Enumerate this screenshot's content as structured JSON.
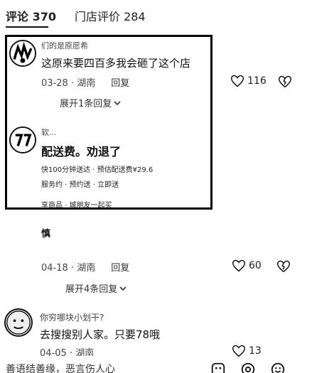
{
  "tabs": [
    {
      "label": "评论 370"
    },
    {
      "label": "门店评价 284"
    }
  ],
  "comments": [
    {
      "username": "们的是原愿希",
      "text": "这原来要四百多我会砸了这个店",
      "date": "03-28",
      "location": "湖南",
      "reply_label": "回复",
      "likes": "116",
      "expand_label": "展开1条回复"
    },
    {
      "username": "软...",
      "text": "配送费。劝退了",
      "line1": "快100分钟送达 · 预估配送费¥29.6",
      "line2": "服务约 · 预约送 · 立即送",
      "line3": "享商品 · 城朋友一起买"
    },
    {
      "text": "慎",
      "date": "04-18",
      "location": "湖南",
      "reply_label": "回复",
      "likes": "60",
      "expand_label": "展开4条回复"
    },
    {
      "username": "你穷哪块小划干?",
      "text": "去搜搜别人家。只要78哦",
      "date": "04-05",
      "location": "湖南",
      "likes": "13"
    }
  ],
  "bottom": {
    "input_text": "善语结善缘，恶言伤人心"
  },
  "icons": {
    "heart": "heart-outline-icon",
    "dislike": "broken-heart-icon",
    "chevron": "chevron-down-icon"
  }
}
